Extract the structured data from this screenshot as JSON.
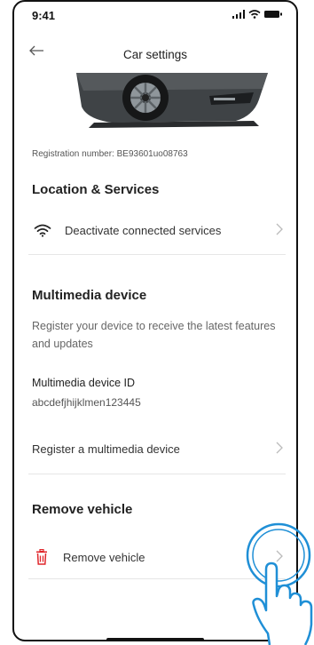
{
  "status_bar": {
    "time": "9:41"
  },
  "header": {
    "title": "Car settings"
  },
  "registration": {
    "text": "Registration number: BE93601uo08763"
  },
  "location_services": {
    "title": "Location & Services",
    "item_label": "Deactivate connected services",
    "item_icon": "wifi-icon"
  },
  "multimedia": {
    "title": "Multimedia device",
    "description": "Register your device to receive the latest features and updates",
    "device_id_label": "Multimedia device ID",
    "device_id_value": "abcdefjhijklmen123445",
    "register_label": "Register a multimedia device"
  },
  "remove_vehicle": {
    "title": "Remove vehicle",
    "item_label": "Remove vehicle",
    "item_icon": "trash-icon",
    "icon_color": "#e0262b"
  }
}
